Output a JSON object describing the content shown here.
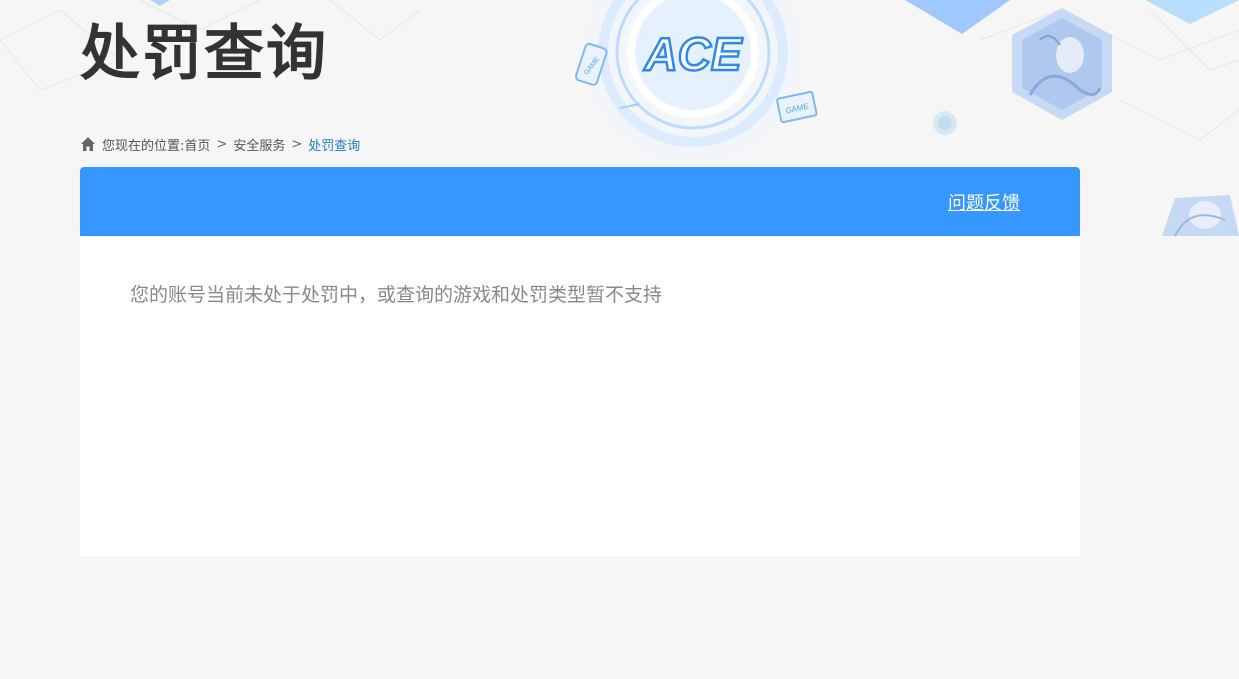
{
  "page": {
    "title": "处罚查询"
  },
  "breadcrumb": {
    "prefix": "您现在的位置:",
    "items": [
      {
        "label": "首页"
      },
      {
        "label": "安全服务"
      },
      {
        "label": "处罚查询"
      }
    ],
    "separator": ">"
  },
  "panel": {
    "feedback_label": "问题反馈",
    "message": "您的账号当前未处于处罚中，或查询的游戏和处罚类型暂不支持"
  },
  "decor": {
    "logo_text": "ACE",
    "game_tag": "GAME"
  },
  "colors": {
    "accent": "#3597ff",
    "breadcrumb_active": "#1a7ad6",
    "background": "#f6f6f6"
  }
}
